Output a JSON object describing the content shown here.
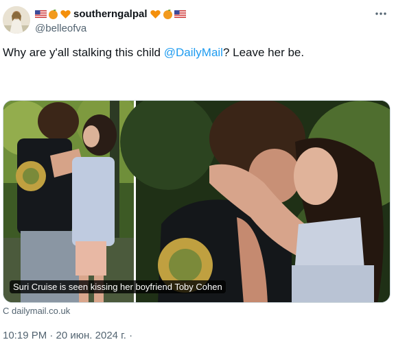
{
  "author": {
    "display_name": "southerngalpal",
    "handle": "@belleofva",
    "avatar": "avatar-photo",
    "name_emojis_before": [
      "us-flag-emoji",
      "orange-emoji",
      "orange-heart-emoji"
    ],
    "name_emojis_after": [
      "orange-heart-emoji",
      "orange-emoji",
      "us-flag-emoji"
    ]
  },
  "tweet": {
    "text_before": "Why are y'all stalking this child ",
    "mention": "@DailyMail",
    "text_after": "? Leave her be."
  },
  "card": {
    "caption": "Suri Cruise is seen kissing her boyfriend Toby Cohen",
    "domain": "C dailymail.co.uk"
  },
  "meta": {
    "timestamp": "10:19 PM · 20 июн. 2024 г. ·"
  },
  "icons": {
    "more": "more-options-icon"
  },
  "colors": {
    "text": "#0f1419",
    "secondary": "#536471",
    "link": "#1d9bf0",
    "border": "#cfd9de"
  }
}
